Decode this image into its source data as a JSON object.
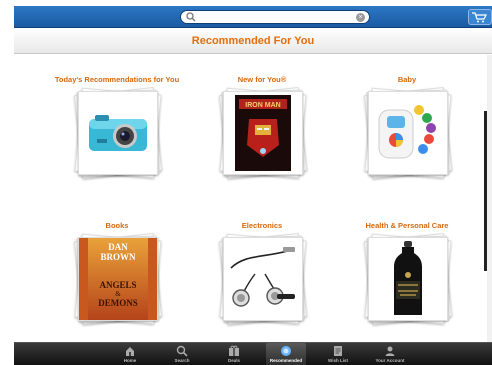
{
  "header": {
    "search_placeholder": "",
    "title": "Recommended For You"
  },
  "tiles": [
    {
      "label": "Today's Recommendations for You",
      "product": "camera-image"
    },
    {
      "label": "New for You®",
      "product": "iron-man-dvd-image"
    },
    {
      "label": "Baby",
      "product": "baby-toy-image"
    },
    {
      "label": "Books",
      "product": "book-cover-image",
      "book": {
        "author_line1": "DAN",
        "author_line2": "BROWN",
        "title_line1": "ANGELS",
        "title_line2": "&",
        "title_line3": "DEMONS"
      }
    },
    {
      "label": "Electronics",
      "product": "earbuds-image"
    },
    {
      "label": "Health & Personal Care",
      "product": "water-bottle-image"
    }
  ],
  "tabs": [
    {
      "label": "Home",
      "icon": "home-icon"
    },
    {
      "label": "Search",
      "icon": "search-icon"
    },
    {
      "label": "Deals",
      "icon": "deals-icon"
    },
    {
      "label": "Recommended",
      "icon": "recommended-icon",
      "active": true
    },
    {
      "label": "Wish List",
      "icon": "wish-list-icon"
    },
    {
      "label": "Your Account",
      "icon": "account-icon"
    }
  ],
  "colors": {
    "topbar_blue": "#1a5aa3",
    "title_orange": "#e26f0c",
    "tabbar_dark": "#111111"
  }
}
